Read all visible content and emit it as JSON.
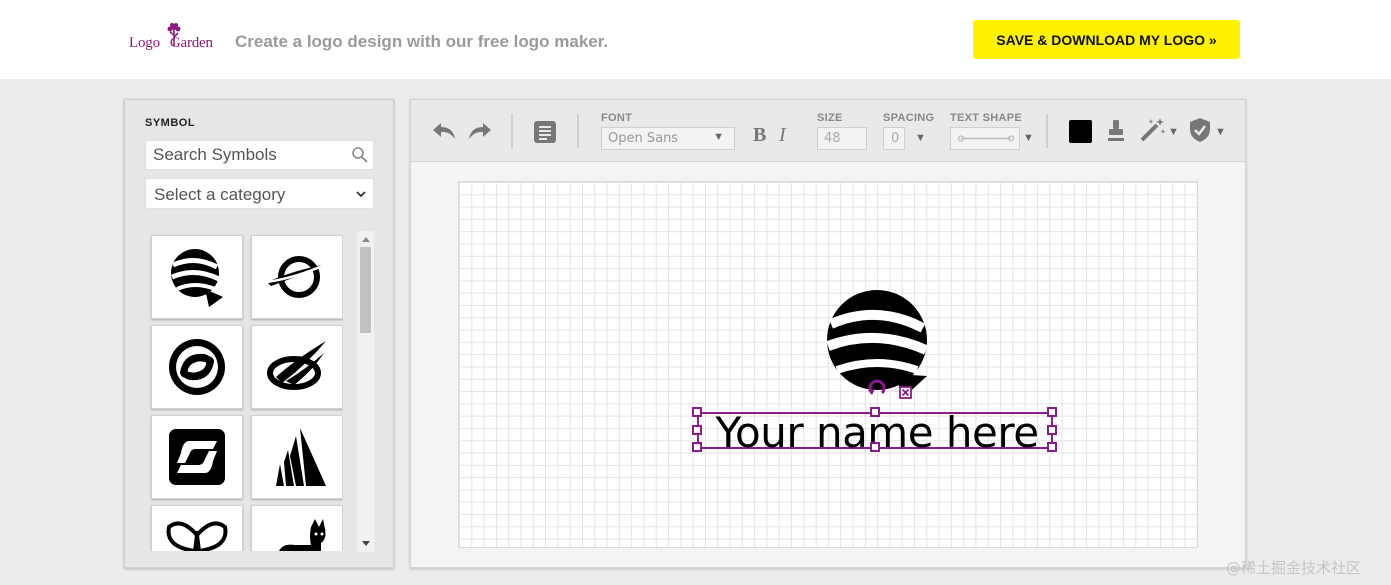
{
  "brand": {
    "logo_text_left": "Logo",
    "logo_text_right": "Garden",
    "tagline": "Create a logo design with our free logo maker."
  },
  "header": {
    "save_button_label": "SAVE & DOWNLOAD MY LOGO »",
    "save_button_color": "#fff200"
  },
  "symbol_panel": {
    "title": "SYMBOL",
    "search_placeholder": "Search Symbols",
    "category_label": "Select a category",
    "symbols": [
      "globe-arrow-icon",
      "swoosh-ring-icon",
      "circle-swirl-icon",
      "orbit-swoosh-icon",
      "s-tile-icon",
      "tower-blades-icon",
      "butterfly-icon",
      "cat-icon"
    ]
  },
  "toolbar": {
    "font_label": "FONT",
    "font_value": "Open Sans",
    "bold_label": "B",
    "italic_label": "I",
    "size_label": "SIZE",
    "size_value": "48",
    "spacing_label": "SPACING",
    "spacing_value": "0",
    "text_shape_label": "TEXT SHAPE",
    "text_color": "#000000"
  },
  "canvas": {
    "logo_name": "Your name here",
    "selection_color": "#8a1b8b"
  },
  "watermark": "@稀土掘金技术社区"
}
